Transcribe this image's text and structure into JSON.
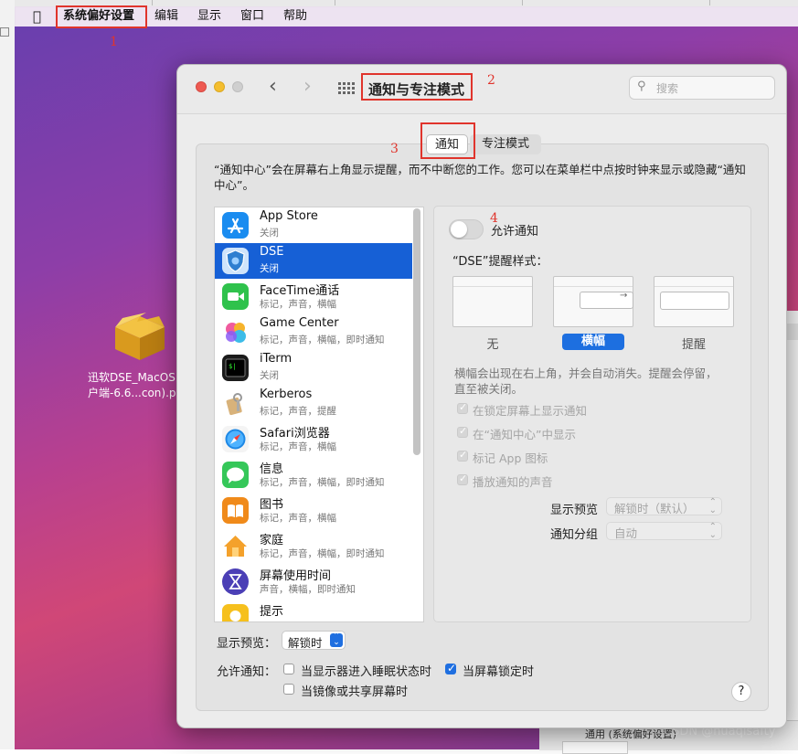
{
  "menubar": {
    "apple": "",
    "app_menu": "系统偏好设置",
    "items": [
      "编辑",
      "显示",
      "窗口",
      "帮助"
    ]
  },
  "annotations": [
    "1",
    "2",
    "3",
    "4"
  ],
  "desktop": {
    "file_label_line1": "迅软DSE_MacOS",
    "file_label_line2": "户端-6.6...con).p"
  },
  "window": {
    "title": "通知与专注模式",
    "search_placeholder": "搜索",
    "tabs": [
      "通知",
      "专注模式"
    ],
    "description": "“通知中心”会在屏幕右上角显示提醒，而不中断您的工作。您可以在菜单栏中点按时钟来显示或隐藏“通知中心”。",
    "apps": [
      {
        "name": "App Store",
        "sub": "关闭",
        "icon": "app-store-icon",
        "color": "#1a8cf0"
      },
      {
        "name": "DSE",
        "sub": "关闭",
        "icon": "dse-shield-icon",
        "color": "#2f7fd0"
      },
      {
        "name": "FaceTime通话",
        "sub": "标记，声音，横幅",
        "icon": "facetime-icon",
        "color": "#2fc24c"
      },
      {
        "name": "Game Center",
        "sub": "标记，声音，横幅，即时通知",
        "icon": "game-center-icon",
        "color": "#e84a8f"
      },
      {
        "name": "iTerm",
        "sub": "关闭",
        "icon": "iterm-icon",
        "color": "#1b1b1b"
      },
      {
        "name": "Kerberos",
        "sub": "标记，声音，提醒",
        "icon": "kerberos-icon",
        "color": "#c9a36b"
      },
      {
        "name": "Safari浏览器",
        "sub": "标记，声音，横幅",
        "icon": "safari-icon",
        "color": "#1e88e5"
      },
      {
        "name": "信息",
        "sub": "标记，声音，横幅，即时通知",
        "icon": "messages-icon",
        "color": "#35c759"
      },
      {
        "name": "图书",
        "sub": "标记，声音，横幅",
        "icon": "books-icon",
        "color": "#f08a1a"
      },
      {
        "name": "家庭",
        "sub": "标记，声音，横幅，即时通知",
        "icon": "home-icon",
        "color": "#f4a12b"
      },
      {
        "name": "屏幕使用时间",
        "sub": "声音，横幅，即时通知",
        "icon": "screen-time-icon",
        "color": "#4b3fb6"
      },
      {
        "name": "提示",
        "sub": "",
        "icon": "tips-icon",
        "color": "#f6c01d"
      }
    ],
    "detail": {
      "allow_label": "允许通知",
      "style_label": "“DSE”提醒样式：",
      "styles": [
        "无",
        "横幅",
        "提醒"
      ],
      "selected_style": "横幅",
      "banner_desc": "横幅会出现在右上角，并会自动消失。提醒会停留，直至被关闭。",
      "options": [
        "在锁定屏幕上显示通知",
        "在“通知中心”中显示",
        "标记 App 图标",
        "播放通知的声音"
      ],
      "preview_label": "显示预览",
      "preview_value": "解锁时（默认）",
      "group_label": "通知分组",
      "group_value": "自动"
    },
    "bottom": {
      "preview_label": "显示预览：",
      "preview_value": "解锁时",
      "allow_label": "允许通知：",
      "opt_sleep": "当显示器进入睡眠状态时",
      "opt_locked": "当屏幕锁定时",
      "opt_mirror": "当镜像或共享屏幕时",
      "help": "?"
    }
  },
  "background": {
    "bottom_text": "通用 (系统偏好设置)",
    "watermark": "CSDN @huaqisafty"
  }
}
